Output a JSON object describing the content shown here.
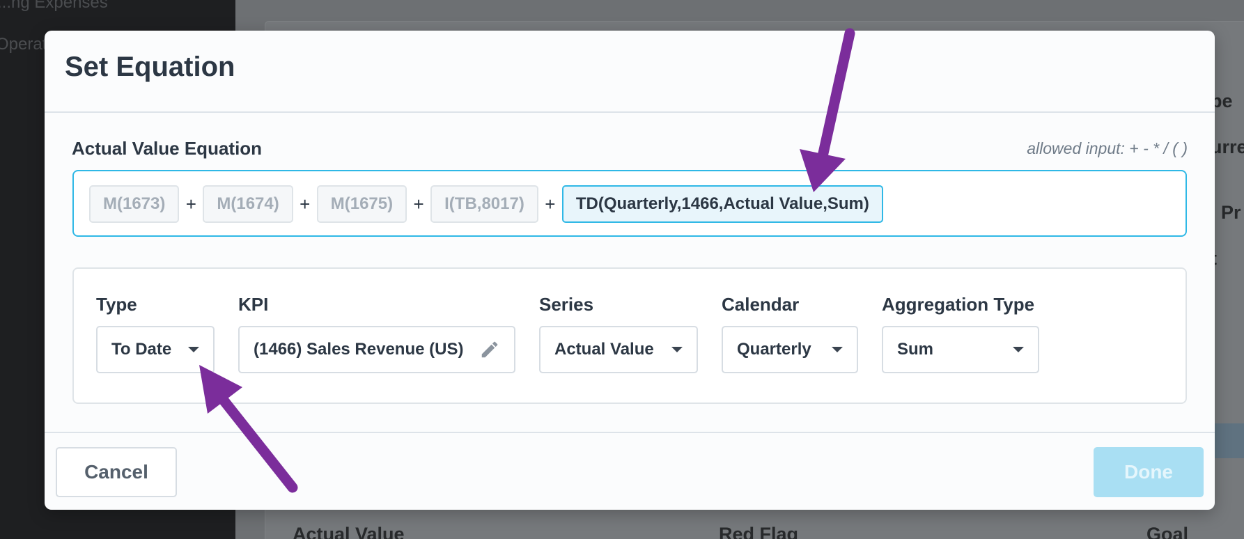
{
  "background": {
    "sidebar_items": [
      "...ng Expenses",
      "Operat..."
    ],
    "right_labels": [
      "pe",
      "urre",
      "l Pr",
      "t"
    ],
    "bottom_labels": [
      "Actual Value",
      "Red Flag",
      "Goal"
    ]
  },
  "modal": {
    "title": "Set Equation",
    "equation": {
      "label": "Actual Value Equation",
      "hint": "allowed input: + - * / ( )",
      "tokens": [
        {
          "text": "M(1673)",
          "active": false
        },
        {
          "text": "M(1674)",
          "active": false
        },
        {
          "text": "M(1675)",
          "active": false
        },
        {
          "text": "I(TB,8017)",
          "active": false
        },
        {
          "text": "TD(Quarterly,1466,Actual Value,Sum)",
          "active": true
        }
      ],
      "operators": [
        "+",
        "+",
        "+",
        "+"
      ]
    },
    "config": {
      "type": {
        "label": "Type",
        "value": "To Date"
      },
      "kpi": {
        "label": "KPI",
        "value": "(1466) Sales Revenue (US)"
      },
      "series": {
        "label": "Series",
        "value": "Actual Value"
      },
      "calendar": {
        "label": "Calendar",
        "value": "Quarterly"
      },
      "aggregation": {
        "label": "Aggregation Type",
        "value": "Sum"
      }
    },
    "buttons": {
      "cancel": "Cancel",
      "done": "Done"
    }
  },
  "colors": {
    "accent": "#2fb8e6",
    "annotation_arrow": "#7b2d9b",
    "done_disabled": "#a9dff3",
    "text_dark": "#2c3744"
  }
}
